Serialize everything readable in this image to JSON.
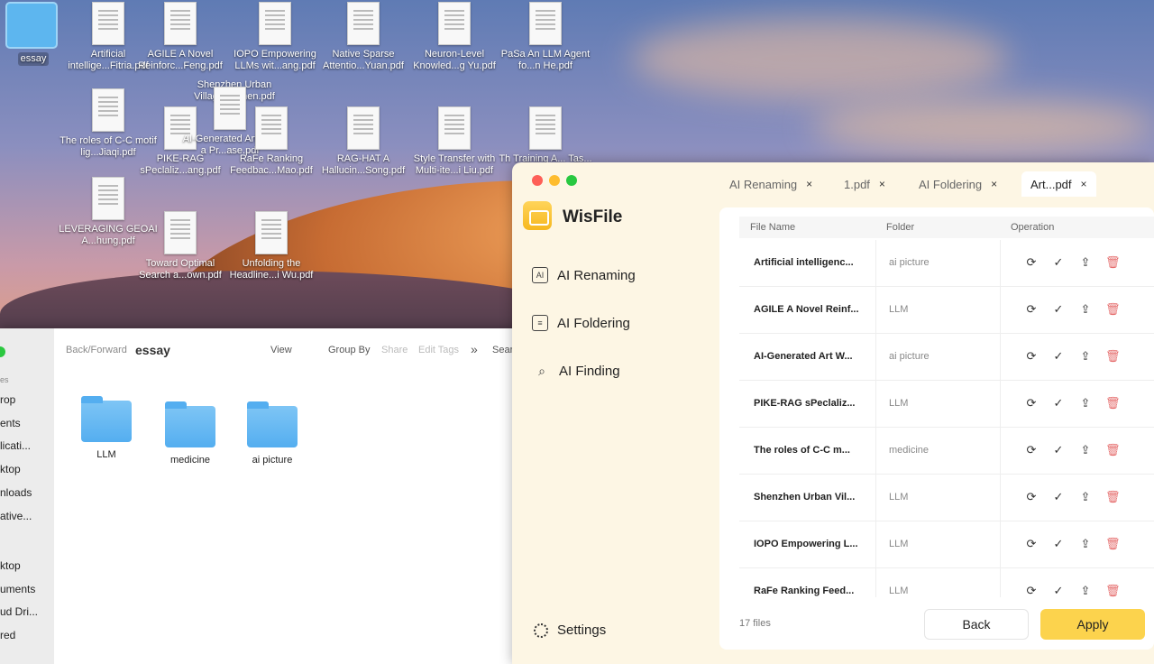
{
  "desktop": {
    "folder_label": "essay",
    "files": [
      {
        "label": "Artificial intellige...Fitria.pdf"
      },
      {
        "label": "AGILE  A Novel Reinforc...Feng.pdf"
      },
      {
        "label": "IOPO  Empowering LLMs wit...ang.pdf"
      },
      {
        "label": "Shenzhen Urban Village U...hen.pdf"
      },
      {
        "label": "Native Sparse Attentio...Yuan.pdf"
      },
      {
        "label": "Neuron-Level Knowled...g Yu.pdf"
      },
      {
        "label": "PaSa  An LLM Agent fo...n He.pdf"
      },
      {
        "label": "The roles of C-C motif lig...Jiaqi.pdf"
      },
      {
        "label": "PIKE-RAG sPeclaliz...ang.pdf"
      },
      {
        "label": "AI-Generated Art W... a Pr...ase.pdf"
      },
      {
        "label": "RaFe  Ranking Feedbac...Mao.pdf"
      },
      {
        "label": "RAG-HAT  A Hallucin...Song.pdf"
      },
      {
        "label": "Style Transfer with Multi-ite...i Liu.pdf"
      },
      {
        "label": "Th  Training  A... Tas..."
      },
      {
        "label": "LEVERAGING GEOAI A...hung.pdf"
      },
      {
        "label": "Toward Optimal Search a...own.pdf"
      },
      {
        "label": "Unfolding the Headline...i Wu.pdf"
      }
    ]
  },
  "finder": {
    "sidebar": [
      "es",
      "rop",
      "ents",
      "licati...",
      "ktop",
      "nloads",
      "ative...",
      "ktop",
      "uments",
      "ud Dri...",
      "red"
    ],
    "toolbar": {
      "back_forward": "Back/Forward",
      "title": "essay",
      "view": "View",
      "group_by": "Group By",
      "share": "Share",
      "edit_tags": "Edit Tags",
      "more": "»",
      "search": "Search"
    },
    "folders": [
      {
        "label": "LLM"
      },
      {
        "label": "medicine"
      },
      {
        "label": "ai picture"
      }
    ]
  },
  "wisfile": {
    "tabs": [
      {
        "label": "AI Renaming",
        "close": "×"
      },
      {
        "label": "1.pdf",
        "close": "×"
      },
      {
        "label": "AI Foldering",
        "close": "×"
      },
      {
        "label": "Art...pdf",
        "close": "×"
      }
    ],
    "brand": "WisFile",
    "nav": [
      {
        "label": "AI Renaming",
        "icon": "AI"
      },
      {
        "label": "AI Foldering",
        "icon": "≡"
      },
      {
        "label": "AI Finding",
        "icon": "⌕"
      }
    ],
    "settings_label": "Settings",
    "table": {
      "headers": {
        "file_name": "File Name",
        "folder": "Folder",
        "operation": "Operation"
      },
      "rows": [
        {
          "name": "Artificial intelligenc...",
          "folder": "ai picture"
        },
        {
          "name": "AGILE A Novel Reinf...",
          "folder": "LLM"
        },
        {
          "name": "AI-Generated Art W...",
          "folder": "ai picture"
        },
        {
          "name": "PIKE-RAG sPeclaliz...",
          "folder": "LLM"
        },
        {
          "name": "The roles of C-C m...",
          "folder": "medicine"
        },
        {
          "name": "Shenzhen Urban Vil...",
          "folder": "LLM"
        },
        {
          "name": "IOPO Empowering L...",
          "folder": "LLM"
        },
        {
          "name": "RaFe Ranking Feed...",
          "folder": "LLM"
        }
      ]
    },
    "footer": {
      "count": "17 files",
      "back": "Back",
      "apply": "Apply"
    },
    "colors": {
      "accent": "#fcd34d",
      "delete": "#e56c6c"
    }
  }
}
